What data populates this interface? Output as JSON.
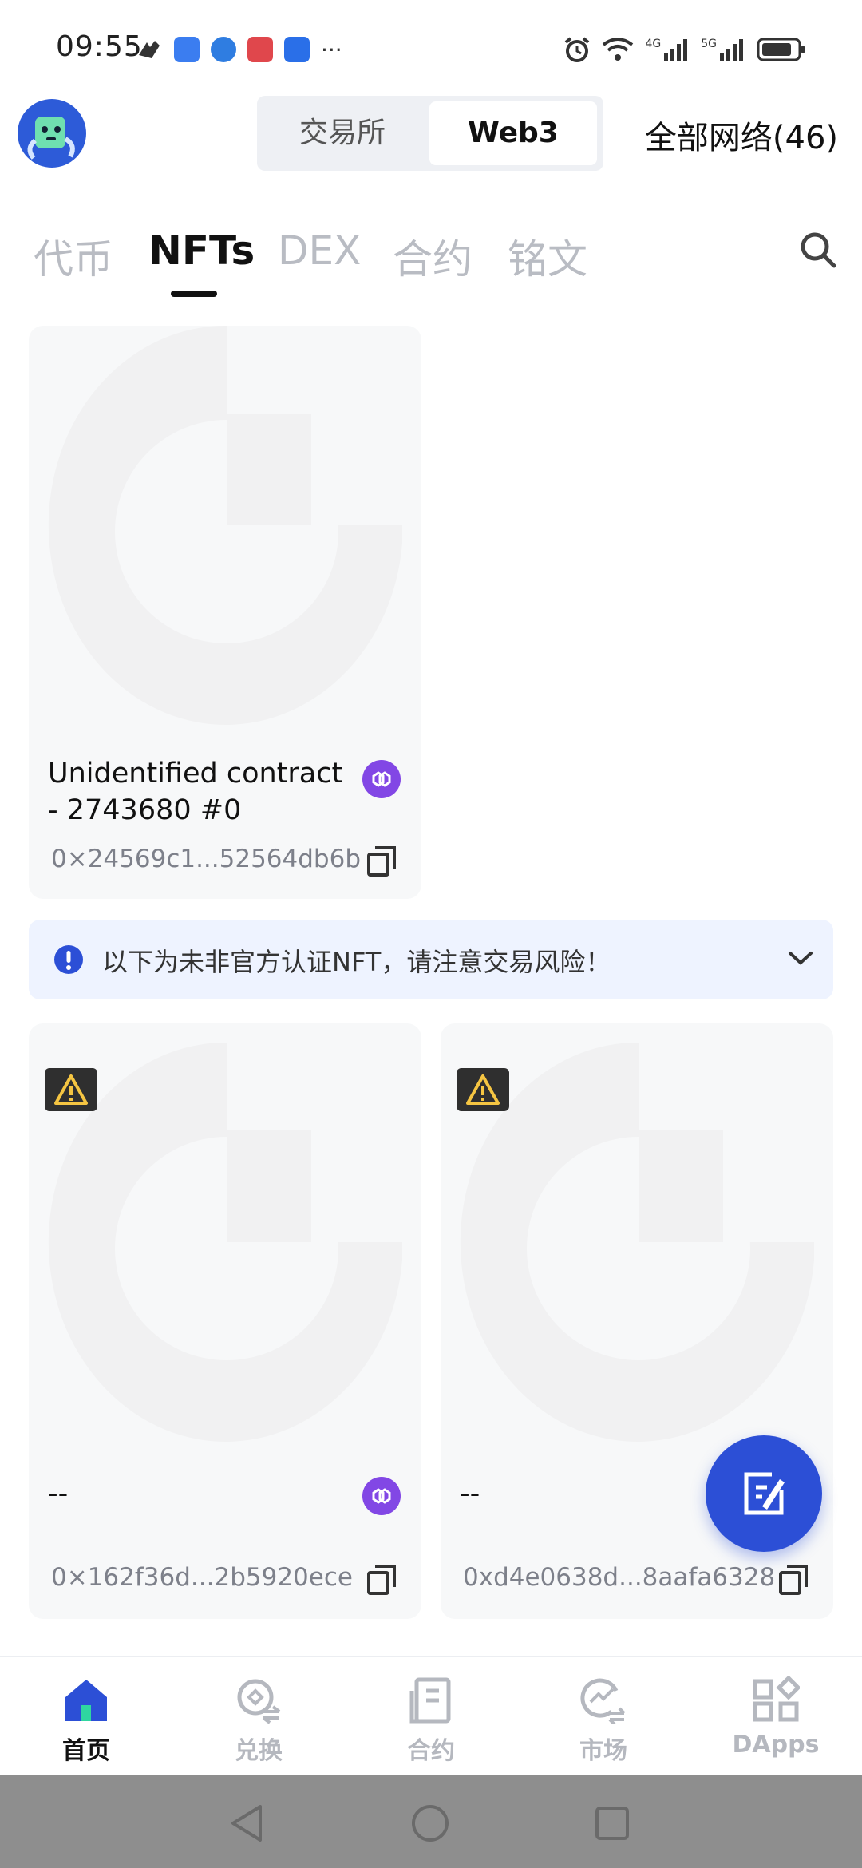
{
  "status_bar": {
    "time": "09:55",
    "network_left": "4G",
    "network_right": "5G",
    "more": "···"
  },
  "header": {
    "segment": {
      "exchange_label": "交易所",
      "web3_label": "Web3"
    },
    "network_selector": "全部网络(46)"
  },
  "tabs": [
    {
      "label": "代币",
      "active": false
    },
    {
      "label": "NFTs",
      "active": true
    },
    {
      "label": "DEX",
      "active": false
    },
    {
      "label": "合约",
      "active": false
    },
    {
      "label": "铭文",
      "active": false
    }
  ],
  "featured_nft": {
    "title_line1": "Unidentified contract",
    "title_line2": "- 2743680 #0",
    "address": "0×24569c1...52564db6b"
  },
  "notice": {
    "text": "以下为未非官方认证NFT，请注意交易风险！"
  },
  "unverified_nfts": [
    {
      "title": "--",
      "address": "0×162f36d...2b5920ece"
    },
    {
      "title": "--",
      "address": "0xd4e0638d...8aafa6328"
    }
  ],
  "bottom_nav": [
    {
      "label": "首页",
      "icon": "home-icon",
      "active": true
    },
    {
      "label": "兑换",
      "icon": "swap-icon",
      "active": false
    },
    {
      "label": "合约",
      "icon": "contract-icon",
      "active": false
    },
    {
      "label": "市场",
      "icon": "market-icon",
      "active": false
    },
    {
      "label": "DApps",
      "icon": "dapps-icon",
      "active": false
    }
  ],
  "colors": {
    "accent": "#2c4fd6",
    "polygon": "#8247e5",
    "warning": "#f5c542",
    "inactive_tab": "#b9bcc3"
  }
}
